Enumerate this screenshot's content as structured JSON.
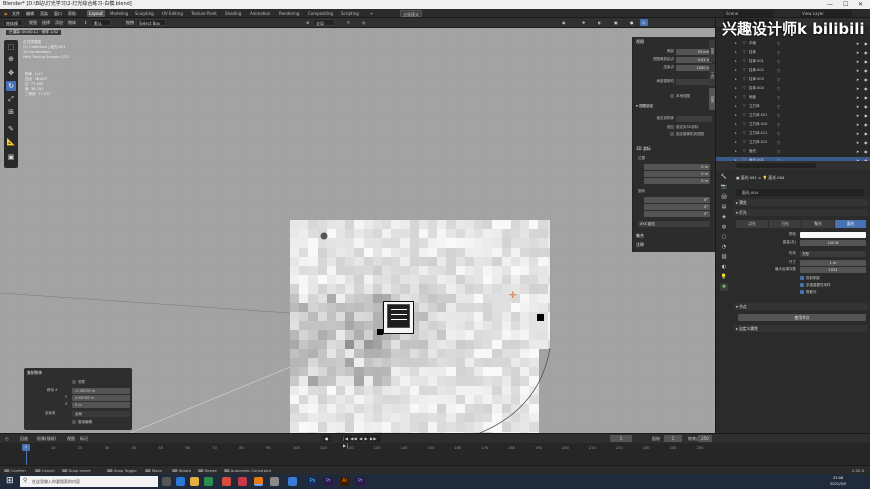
{
  "titlebar": {
    "title": "Blender* [D:\\B站\\灯光学习\\2-灯光综合练习-白模.blend]",
    "min": "—",
    "max": "☐",
    "close": "✕"
  },
  "topmenu": {
    "items": [
      "文件",
      "编辑",
      "渲染",
      "窗口",
      "帮助"
    ],
    "workspaces": [
      "Layout",
      "Modeling",
      "Sculpting",
      "UV Editing",
      "Texture Paint",
      "Shading",
      "Animation",
      "Rendering",
      "Compositing",
      "Scripting"
    ],
    "active_workspace": "Layout",
    "scene": "Scene",
    "view_layer": "View Layer"
  },
  "viewport_header": {
    "mode": "物体模式",
    "view": "视图",
    "select": "选择",
    "add": "添加",
    "object": "物体",
    "orientation": "默认",
    "drag": "拖拽",
    "select_box": "Select Box",
    "global": "全局"
  },
  "viewport": {
    "overlay_lines": [
      "正交顶视图",
      "(1) Collection | 面光.001",
      "10 Centimeters",
      "Path Tracing Sample 1/32",
      "物体",
      "顶点",
      "边",
      "面",
      "三角面"
    ],
    "stats_values": [
      "1/17",
      "38,847",
      "77,640",
      "38,793",
      "77,572"
    ],
    "status_info": "已渲染: 00:00.11 · 采样 1/32"
  },
  "npanel": {
    "view_title": "视图",
    "view_rows": [
      {
        "label": "焦距",
        "value": "50 mm"
      },
      {
        "label": "视图裁剪起点",
        "value": "0.01 m"
      },
      {
        "label": "结束点",
        "value": "1000 m"
      }
    ],
    "local_camera": "局部摄像机",
    "lock_object": "锁定到物体",
    "lock": "锁定",
    "lock_3d_cursor": "锁定到3D游标",
    "lock_camera_to_view": "锁定摄像机到视图",
    "cursor_title": "3D 游标",
    "location": "位置",
    "loc_rows": [
      {
        "label": "X",
        "value": "0 m"
      },
      {
        "label": "Y",
        "value": "0 m"
      },
      {
        "label": "Z",
        "value": "0 m"
      }
    ],
    "rotation": "旋转",
    "rot_rows": [
      {
        "label": "X",
        "value": "0°"
      },
      {
        "label": "Y",
        "value": "0°"
      },
      {
        "label": "Z",
        "value": "0°"
      }
    ],
    "rot_mode": "XYZ 欧拉",
    "collections": "集合",
    "annotations": "注释",
    "tabs": [
      "物体",
      "工具",
      "视图"
    ]
  },
  "redo_panel": {
    "title": "复制物体",
    "linked": "关联",
    "rows": [
      {
        "label": "移动 X",
        "value": "-0.28705 m"
      },
      {
        "label": "Y",
        "value": "0.68708 m"
      },
      {
        "label": "Z",
        "value": "0 m"
      },
      {
        "label": "坐标系",
        "value": "全局"
      }
    ],
    "proportional": "衰减编辑"
  },
  "outliner": {
    "rows": [
      {
        "name": "平面",
        "selected": false
      },
      {
        "name": "柱体",
        "selected": false
      },
      {
        "name": "柱体.001",
        "selected": false
      },
      {
        "name": "柱体.002",
        "selected": false
      },
      {
        "name": "柱体.003",
        "selected": false
      },
      {
        "name": "柱体.004",
        "selected": false
      },
      {
        "name": "地板",
        "selected": false
      },
      {
        "name": "立方体",
        "selected": false
      },
      {
        "name": "立方体.001",
        "selected": false
      },
      {
        "name": "立方体.010",
        "selected": false
      },
      {
        "name": "立方体.011",
        "selected": false
      },
      {
        "name": "立方体.012",
        "selected": false
      },
      {
        "name": "面光",
        "selected": false
      },
      {
        "name": "面光.001",
        "selected": true
      }
    ]
  },
  "properties": {
    "object_name": "面光.001",
    "data_name": "面光.004",
    "light_data": "面光.004",
    "sections": {
      "preview": "预览",
      "light": "灯光",
      "nodes": "节点",
      "custom": "自定义属性"
    },
    "light_types": [
      "点光",
      "日光",
      "聚光",
      "面光"
    ],
    "active_light_type": "面光",
    "rows": [
      {
        "label": "颜色",
        "value": ""
      },
      {
        "label": "能量(瓦)",
        "value": "100 W"
      },
      {
        "label": "形状",
        "value": "方形"
      },
      {
        "label": "尺寸",
        "value": "1 m"
      },
      {
        "label": "最大反弹次数",
        "value": "1024"
      }
    ],
    "checks": [
      "投射阴影",
      "多重重要性采样",
      "焦散光"
    ],
    "use_nodes": "使用节点"
  },
  "timeline": {
    "playback": "回放",
    "keying": "抠像(插帧)",
    "view": "视图",
    "marker": "标记",
    "current_frame": "1",
    "start_label": "起始",
    "start": "1",
    "end_label": "结束点",
    "end": "250",
    "ticks": [
      "0",
      "10",
      "20",
      "30",
      "40",
      "50",
      "60",
      "70",
      "80",
      "90",
      "100",
      "110",
      "120",
      "130",
      "140",
      "150",
      "160",
      "170",
      "180",
      "190",
      "200",
      "210",
      "220",
      "230",
      "240",
      "250"
    ]
  },
  "statusbar": {
    "items": [
      "Confirm",
      "Cancel",
      "Snap Invert",
      "Snap Toggle",
      "Move",
      "Rotate",
      "Resize",
      "Automatic Constraint"
    ],
    "version": "2.92.0"
  },
  "taskbar": {
    "search_placeholder": "在这里输入你要搜索的内容",
    "time": "23:08",
    "date": "2021/9/5"
  },
  "watermark": "兴趣设计师k bilibili"
}
